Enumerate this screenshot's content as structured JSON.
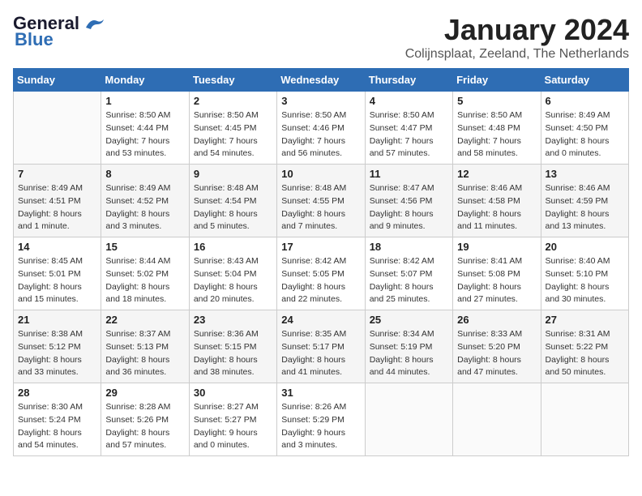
{
  "logo": {
    "line1": "General",
    "line2": "Blue"
  },
  "title": "January 2024",
  "location": "Colijnsplaat, Zeeland, The Netherlands",
  "days_of_week": [
    "Sunday",
    "Monday",
    "Tuesday",
    "Wednesday",
    "Thursday",
    "Friday",
    "Saturday"
  ],
  "weeks": [
    [
      {
        "day": "",
        "info": ""
      },
      {
        "day": "1",
        "info": "Sunrise: 8:50 AM\nSunset: 4:44 PM\nDaylight: 7 hours\nand 53 minutes."
      },
      {
        "day": "2",
        "info": "Sunrise: 8:50 AM\nSunset: 4:45 PM\nDaylight: 7 hours\nand 54 minutes."
      },
      {
        "day": "3",
        "info": "Sunrise: 8:50 AM\nSunset: 4:46 PM\nDaylight: 7 hours\nand 56 minutes."
      },
      {
        "day": "4",
        "info": "Sunrise: 8:50 AM\nSunset: 4:47 PM\nDaylight: 7 hours\nand 57 minutes."
      },
      {
        "day": "5",
        "info": "Sunrise: 8:50 AM\nSunset: 4:48 PM\nDaylight: 7 hours\nand 58 minutes."
      },
      {
        "day": "6",
        "info": "Sunrise: 8:49 AM\nSunset: 4:50 PM\nDaylight: 8 hours\nand 0 minutes."
      }
    ],
    [
      {
        "day": "7",
        "info": "Sunrise: 8:49 AM\nSunset: 4:51 PM\nDaylight: 8 hours\nand 1 minute."
      },
      {
        "day": "8",
        "info": "Sunrise: 8:49 AM\nSunset: 4:52 PM\nDaylight: 8 hours\nand 3 minutes."
      },
      {
        "day": "9",
        "info": "Sunrise: 8:48 AM\nSunset: 4:54 PM\nDaylight: 8 hours\nand 5 minutes."
      },
      {
        "day": "10",
        "info": "Sunrise: 8:48 AM\nSunset: 4:55 PM\nDaylight: 8 hours\nand 7 minutes."
      },
      {
        "day": "11",
        "info": "Sunrise: 8:47 AM\nSunset: 4:56 PM\nDaylight: 8 hours\nand 9 minutes."
      },
      {
        "day": "12",
        "info": "Sunrise: 8:46 AM\nSunset: 4:58 PM\nDaylight: 8 hours\nand 11 minutes."
      },
      {
        "day": "13",
        "info": "Sunrise: 8:46 AM\nSunset: 4:59 PM\nDaylight: 8 hours\nand 13 minutes."
      }
    ],
    [
      {
        "day": "14",
        "info": "Sunrise: 8:45 AM\nSunset: 5:01 PM\nDaylight: 8 hours\nand 15 minutes."
      },
      {
        "day": "15",
        "info": "Sunrise: 8:44 AM\nSunset: 5:02 PM\nDaylight: 8 hours\nand 18 minutes."
      },
      {
        "day": "16",
        "info": "Sunrise: 8:43 AM\nSunset: 5:04 PM\nDaylight: 8 hours\nand 20 minutes."
      },
      {
        "day": "17",
        "info": "Sunrise: 8:42 AM\nSunset: 5:05 PM\nDaylight: 8 hours\nand 22 minutes."
      },
      {
        "day": "18",
        "info": "Sunrise: 8:42 AM\nSunset: 5:07 PM\nDaylight: 8 hours\nand 25 minutes."
      },
      {
        "day": "19",
        "info": "Sunrise: 8:41 AM\nSunset: 5:08 PM\nDaylight: 8 hours\nand 27 minutes."
      },
      {
        "day": "20",
        "info": "Sunrise: 8:40 AM\nSunset: 5:10 PM\nDaylight: 8 hours\nand 30 minutes."
      }
    ],
    [
      {
        "day": "21",
        "info": "Sunrise: 8:38 AM\nSunset: 5:12 PM\nDaylight: 8 hours\nand 33 minutes."
      },
      {
        "day": "22",
        "info": "Sunrise: 8:37 AM\nSunset: 5:13 PM\nDaylight: 8 hours\nand 36 minutes."
      },
      {
        "day": "23",
        "info": "Sunrise: 8:36 AM\nSunset: 5:15 PM\nDaylight: 8 hours\nand 38 minutes."
      },
      {
        "day": "24",
        "info": "Sunrise: 8:35 AM\nSunset: 5:17 PM\nDaylight: 8 hours\nand 41 minutes."
      },
      {
        "day": "25",
        "info": "Sunrise: 8:34 AM\nSunset: 5:19 PM\nDaylight: 8 hours\nand 44 minutes."
      },
      {
        "day": "26",
        "info": "Sunrise: 8:33 AM\nSunset: 5:20 PM\nDaylight: 8 hours\nand 47 minutes."
      },
      {
        "day": "27",
        "info": "Sunrise: 8:31 AM\nSunset: 5:22 PM\nDaylight: 8 hours\nand 50 minutes."
      }
    ],
    [
      {
        "day": "28",
        "info": "Sunrise: 8:30 AM\nSunset: 5:24 PM\nDaylight: 8 hours\nand 54 minutes."
      },
      {
        "day": "29",
        "info": "Sunrise: 8:28 AM\nSunset: 5:26 PM\nDaylight: 8 hours\nand 57 minutes."
      },
      {
        "day": "30",
        "info": "Sunrise: 8:27 AM\nSunset: 5:27 PM\nDaylight: 9 hours\nand 0 minutes."
      },
      {
        "day": "31",
        "info": "Sunrise: 8:26 AM\nSunset: 5:29 PM\nDaylight: 9 hours\nand 3 minutes."
      },
      {
        "day": "",
        "info": ""
      },
      {
        "day": "",
        "info": ""
      },
      {
        "day": "",
        "info": ""
      }
    ]
  ]
}
